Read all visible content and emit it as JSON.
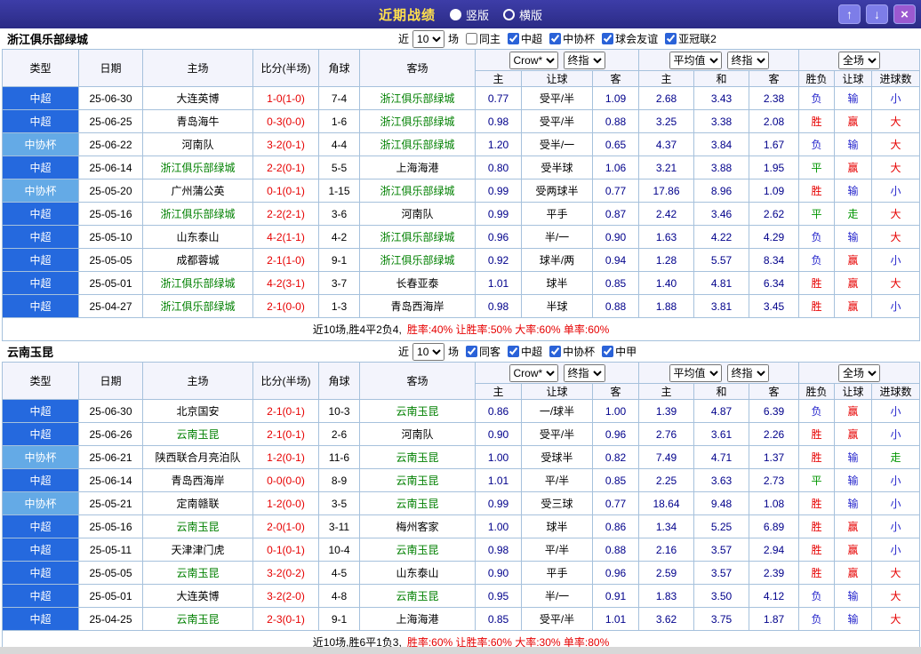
{
  "titlebar": {
    "title": "近期战绩",
    "radios": [
      {
        "label": "竖版",
        "selected": true
      },
      {
        "label": "横版",
        "selected": false
      }
    ],
    "buttons": {
      "up": "↑",
      "down": "↓",
      "close": "×"
    }
  },
  "colors": {
    "type_colors": {
      "中超": "#2569de",
      "中协杯": "#64aae6"
    },
    "result_class_map": {
      "胜": "c-red",
      "赢": "c-red",
      "大": "c-red",
      "平": "c-green",
      "走": "c-green",
      "负": "c-blue",
      "输": "c-blue",
      "小": "c-blue"
    },
    "accent_red": "#e60000",
    "team_green": "#008000",
    "odds_navy": "#00008b"
  },
  "table_headers": {
    "left": [
      "类型",
      "日期",
      "主场",
      "比分(半场)",
      "角球",
      "客场"
    ],
    "odds_group": {
      "company_select": "Crow*",
      "time_select": "终指",
      "cols": [
        "主",
        "让球",
        "客"
      ]
    },
    "avg_group": {
      "avg_select": "平均值",
      "time_select": "终指",
      "cols": [
        "主",
        "和",
        "客"
      ]
    },
    "result_group": {
      "scope_select": "全场",
      "cols": [
        "胜负",
        "让球",
        "进球数"
      ]
    }
  },
  "sections": [
    {
      "team": "浙江俱乐部绿城",
      "filter": {
        "label_before": "近",
        "count": "10",
        "label_after": "场",
        "checkboxes": [
          {
            "label": "同主",
            "checked": false
          },
          {
            "label": "中超",
            "checked": true
          },
          {
            "label": "中协杯",
            "checked": true
          },
          {
            "label": "球会友谊",
            "checked": true
          },
          {
            "label": "亚冠联2",
            "checked": true
          }
        ]
      },
      "rows": [
        {
          "type": "中超",
          "date": "25-06-30",
          "home": "大连英博",
          "score": "1-0(1-0)",
          "corners": "7-4",
          "away": "浙江俱乐部绿城",
          "odds_home": "0.77",
          "handicap": "受平/半",
          "odds_away": "1.09",
          "avg_home": "2.68",
          "avg_draw": "3.43",
          "avg_away": "2.38",
          "result": "负",
          "result_handicap": "输",
          "result_goals": "小"
        },
        {
          "type": "中超",
          "date": "25-06-25",
          "home": "青岛海牛",
          "score": "0-3(0-0)",
          "corners": "1-6",
          "away": "浙江俱乐部绿城",
          "odds_home": "0.98",
          "handicap": "受平/半",
          "odds_away": "0.88",
          "avg_home": "3.25",
          "avg_draw": "3.38",
          "avg_away": "2.08",
          "result": "胜",
          "result_handicap": "赢",
          "result_goals": "大"
        },
        {
          "type": "中协杯",
          "date": "25-06-22",
          "home": "河南队",
          "score": "3-2(0-1)",
          "corners": "4-4",
          "away": "浙江俱乐部绿城",
          "odds_home": "1.20",
          "handicap": "受半/一",
          "odds_away": "0.65",
          "avg_home": "4.37",
          "avg_draw": "3.84",
          "avg_away": "1.67",
          "result": "负",
          "result_handicap": "输",
          "result_goals": "大"
        },
        {
          "type": "中超",
          "date": "25-06-14",
          "home": "浙江俱乐部绿城",
          "score": "2-2(0-1)",
          "corners": "5-5",
          "away": "上海海港",
          "odds_home": "0.80",
          "handicap": "受半球",
          "odds_away": "1.06",
          "avg_home": "3.21",
          "avg_draw": "3.88",
          "avg_away": "1.95",
          "result": "平",
          "result_handicap": "赢",
          "result_goals": "大"
        },
        {
          "type": "中协杯",
          "date": "25-05-20",
          "home": "广州蒲公英",
          "score": "0-1(0-1)",
          "corners": "1-15",
          "away": "浙江俱乐部绿城",
          "odds_home": "0.99",
          "handicap": "受两球半",
          "odds_away": "0.77",
          "avg_home": "17.86",
          "avg_draw": "8.96",
          "avg_away": "1.09",
          "result": "胜",
          "result_handicap": "输",
          "result_goals": "小"
        },
        {
          "type": "中超",
          "date": "25-05-16",
          "home": "浙江俱乐部绿城",
          "score": "2-2(2-1)",
          "corners": "3-6",
          "away": "河南队",
          "odds_home": "0.99",
          "handicap": "平手",
          "odds_away": "0.87",
          "avg_home": "2.42",
          "avg_draw": "3.46",
          "avg_away": "2.62",
          "result": "平",
          "result_handicap": "走",
          "result_goals": "大"
        },
        {
          "type": "中超",
          "date": "25-05-10",
          "home": "山东泰山",
          "score": "4-2(1-1)",
          "corners": "4-2",
          "away": "浙江俱乐部绿城",
          "odds_home": "0.96",
          "handicap": "半/一",
          "odds_away": "0.90",
          "avg_home": "1.63",
          "avg_draw": "4.22",
          "avg_away": "4.29",
          "result": "负",
          "result_handicap": "输",
          "result_goals": "大"
        },
        {
          "type": "中超",
          "date": "25-05-05",
          "home": "成都蓉城",
          "score": "2-1(1-0)",
          "corners": "9-1",
          "away": "浙江俱乐部绿城",
          "odds_home": "0.92",
          "handicap": "球半/两",
          "odds_away": "0.94",
          "avg_home": "1.28",
          "avg_draw": "5.57",
          "avg_away": "8.34",
          "result": "负",
          "result_handicap": "赢",
          "result_goals": "小"
        },
        {
          "type": "中超",
          "date": "25-05-01",
          "home": "浙江俱乐部绿城",
          "score": "4-2(3-1)",
          "corners": "3-7",
          "away": "长春亚泰",
          "odds_home": "1.01",
          "handicap": "球半",
          "odds_away": "0.85",
          "avg_home": "1.40",
          "avg_draw": "4.81",
          "avg_away": "6.34",
          "result": "胜",
          "result_handicap": "赢",
          "result_goals": "大"
        },
        {
          "type": "中超",
          "date": "25-04-27",
          "home": "浙江俱乐部绿城",
          "score": "2-1(0-0)",
          "corners": "1-3",
          "away": "青岛西海岸",
          "odds_home": "0.98",
          "handicap": "半球",
          "odds_away": "0.88",
          "avg_home": "1.88",
          "avg_draw": "3.81",
          "avg_away": "3.45",
          "result": "胜",
          "result_handicap": "赢",
          "result_goals": "小"
        }
      ],
      "summary": {
        "prefix": "近10场,胜4平2负4,",
        "stats": [
          "胜率:40%",
          "让胜率:50%",
          "大率:60%",
          "单率:60%"
        ]
      }
    },
    {
      "team": "云南玉昆",
      "filter": {
        "label_before": "近",
        "count": "10",
        "label_after": "场",
        "checkboxes": [
          {
            "label": "同客",
            "checked": true
          },
          {
            "label": "中超",
            "checked": true
          },
          {
            "label": "中协杯",
            "checked": true
          },
          {
            "label": "中甲",
            "checked": true
          }
        ]
      },
      "rows": [
        {
          "type": "中超",
          "date": "25-06-30",
          "home": "北京国安",
          "score": "2-1(0-1)",
          "corners": "10-3",
          "away": "云南玉昆",
          "odds_home": "0.86",
          "handicap": "一/球半",
          "odds_away": "1.00",
          "avg_home": "1.39",
          "avg_draw": "4.87",
          "avg_away": "6.39",
          "result": "负",
          "result_handicap": "赢",
          "result_goals": "小"
        },
        {
          "type": "中超",
          "date": "25-06-26",
          "home": "云南玉昆",
          "score": "2-1(0-1)",
          "corners": "2-6",
          "away": "河南队",
          "odds_home": "0.90",
          "handicap": "受平/半",
          "odds_away": "0.96",
          "avg_home": "2.76",
          "avg_draw": "3.61",
          "avg_away": "2.26",
          "result": "胜",
          "result_handicap": "赢",
          "result_goals": "小"
        },
        {
          "type": "中协杯",
          "date": "25-06-21",
          "home": "陕西联合月亮泊队",
          "score": "1-2(0-1)",
          "corners": "11-6",
          "away": "云南玉昆",
          "odds_home": "1.00",
          "handicap": "受球半",
          "odds_away": "0.82",
          "avg_home": "7.49",
          "avg_draw": "4.71",
          "avg_away": "1.37",
          "result": "胜",
          "result_handicap": "输",
          "result_goals": "走"
        },
        {
          "type": "中超",
          "date": "25-06-14",
          "home": "青岛西海岸",
          "score": "0-0(0-0)",
          "corners": "8-9",
          "away": "云南玉昆",
          "odds_home": "1.01",
          "handicap": "平/半",
          "odds_away": "0.85",
          "avg_home": "2.25",
          "avg_draw": "3.63",
          "avg_away": "2.73",
          "result": "平",
          "result_handicap": "输",
          "result_goals": "小"
        },
        {
          "type": "中协杯",
          "date": "25-05-21",
          "home": "定南赣联",
          "score": "1-2(0-0)",
          "corners": "3-5",
          "away": "云南玉昆",
          "odds_home": "0.99",
          "handicap": "受三球",
          "odds_away": "0.77",
          "avg_home": "18.64",
          "avg_draw": "9.48",
          "avg_away": "1.08",
          "result": "胜",
          "result_handicap": "输",
          "result_goals": "小"
        },
        {
          "type": "中超",
          "date": "25-05-16",
          "home": "云南玉昆",
          "score": "2-0(1-0)",
          "corners": "3-11",
          "away": "梅州客家",
          "odds_home": "1.00",
          "handicap": "球半",
          "odds_away": "0.86",
          "avg_home": "1.34",
          "avg_draw": "5.25",
          "avg_away": "6.89",
          "result": "胜",
          "result_handicap": "赢",
          "result_goals": "小"
        },
        {
          "type": "中超",
          "date": "25-05-11",
          "home": "天津津门虎",
          "score": "0-1(0-1)",
          "corners": "10-4",
          "away": "云南玉昆",
          "odds_home": "0.98",
          "handicap": "平/半",
          "odds_away": "0.88",
          "avg_home": "2.16",
          "avg_draw": "3.57",
          "avg_away": "2.94",
          "result": "胜",
          "result_handicap": "赢",
          "result_goals": "小"
        },
        {
          "type": "中超",
          "date": "25-05-05",
          "home": "云南玉昆",
          "score": "3-2(0-2)",
          "corners": "4-5",
          "away": "山东泰山",
          "odds_home": "0.90",
          "handicap": "平手",
          "odds_away": "0.96",
          "avg_home": "2.59",
          "avg_draw": "3.57",
          "avg_away": "2.39",
          "result": "胜",
          "result_handicap": "赢",
          "result_goals": "大"
        },
        {
          "type": "中超",
          "date": "25-05-01",
          "home": "大连英博",
          "score": "3-2(2-0)",
          "corners": "4-8",
          "away": "云南玉昆",
          "odds_home": "0.95",
          "handicap": "半/一",
          "odds_away": "0.91",
          "avg_home": "1.83",
          "avg_draw": "3.50",
          "avg_away": "4.12",
          "result": "负",
          "result_handicap": "输",
          "result_goals": "大"
        },
        {
          "type": "中超",
          "date": "25-04-25",
          "home": "云南玉昆",
          "score": "2-3(0-1)",
          "corners": "9-1",
          "away": "上海海港",
          "odds_home": "0.85",
          "handicap": "受平/半",
          "odds_away": "1.01",
          "avg_home": "3.62",
          "avg_draw": "3.75",
          "avg_away": "1.87",
          "result": "负",
          "result_handicap": "输",
          "result_goals": "大"
        }
      ],
      "summary": {
        "prefix": "近10场,胜6平1负3,",
        "stats": [
          "胜率:60%",
          "让胜率:60%",
          "大率:30%",
          "单率:80%"
        ]
      }
    }
  ]
}
